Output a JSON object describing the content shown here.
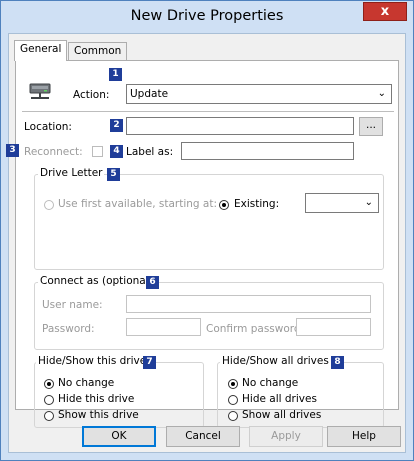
{
  "window": {
    "title": "New Drive Properties",
    "close_label": "x"
  },
  "tabs": [
    {
      "label": "General"
    },
    {
      "label": "Common"
    }
  ],
  "action": {
    "label": "Action:",
    "value": "Update",
    "badge": "1"
  },
  "location": {
    "label": "Location:",
    "value": "",
    "browse_label": "...",
    "badge": "2"
  },
  "reconnect": {
    "label": "Reconnect:",
    "badge": "3",
    "checked": false
  },
  "label_as": {
    "label": "Label as:",
    "value": "",
    "badge": "4"
  },
  "drive_letter": {
    "legend": "Drive Letter",
    "badge": "5",
    "first_available_label": "Use first available, starting at:",
    "existing_label": "Existing:",
    "existing_value": "",
    "selected": "existing"
  },
  "connect_as": {
    "legend": "Connect as (optional)",
    "badge": "6",
    "user_name_label": "User name:",
    "password_label": "Password:",
    "confirm_password_label": "Confirm password:"
  },
  "hide_show_drive": {
    "legend": "Hide/Show this drive",
    "badge": "7",
    "options": [
      "No change",
      "Hide this drive",
      "Show this drive"
    ],
    "selected": 0
  },
  "hide_show_all": {
    "legend": "Hide/Show all drives",
    "badge": "8",
    "options": [
      "No change",
      "Hide all drives",
      "Show all drives"
    ],
    "selected": 0
  },
  "buttons": {
    "ok": "OK",
    "cancel": "Cancel",
    "apply": "Apply",
    "help": "Help"
  }
}
